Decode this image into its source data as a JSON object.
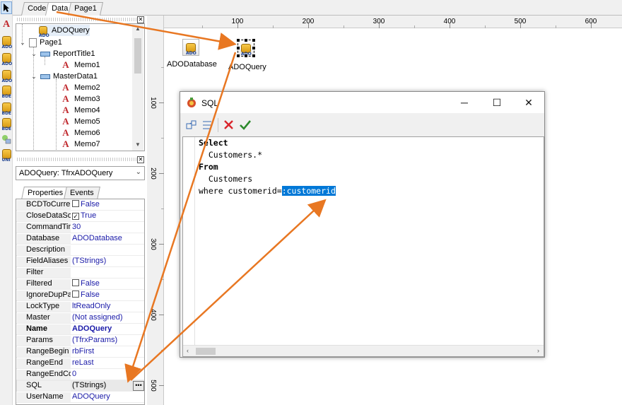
{
  "tabs": [
    "Code",
    "Data",
    "Page1"
  ],
  "palette": {
    "icons": [
      "pointer-icon",
      "text-memo-icon",
      "ado-database-icon",
      "ado-table-icon",
      "ado-query-icon",
      "bde-database-icon",
      "bde-table-icon",
      "bde-query-icon",
      "shapes-icon",
      "uni-database-icon"
    ],
    "badges": [
      "ADO",
      "ADO",
      "ADO",
      "BDE",
      "BDE",
      "BDE",
      "UNI"
    ]
  },
  "tree": {
    "items": [
      {
        "label": "ADOQuery",
        "selected": true
      },
      {
        "label": "Page1"
      },
      {
        "label": "ReportTitle1"
      },
      {
        "label": "Memo1"
      },
      {
        "label": "MasterData1"
      },
      {
        "label": "Memo2"
      },
      {
        "label": "Memo3"
      },
      {
        "label": "Memo4"
      },
      {
        "label": "Memo5"
      },
      {
        "label": "Memo6"
      },
      {
        "label": "Memo7"
      }
    ]
  },
  "object_combo": {
    "value": "ADOQuery: TfrxADOQuery"
  },
  "inspector_tabs": [
    "Properties",
    "Events"
  ],
  "properties": [
    {
      "name": "BCDToCurrer",
      "value": "False",
      "checkbox": false
    },
    {
      "name": "CloseDataSo",
      "value": "True",
      "checkbox": true
    },
    {
      "name": "CommandTim",
      "value": "30"
    },
    {
      "name": "Database",
      "value": "ADODatabase"
    },
    {
      "name": "Description",
      "value": ""
    },
    {
      "name": "FieldAliases",
      "value": "(TStrings)"
    },
    {
      "name": "Filter",
      "value": ""
    },
    {
      "name": "Filtered",
      "value": "False",
      "checkbox": false
    },
    {
      "name": "IgnoreDupPa",
      "value": "False",
      "checkbox": false
    },
    {
      "name": "LockType",
      "value": "ltReadOnly"
    },
    {
      "name": "Master",
      "value": "(Not assigned)"
    },
    {
      "name": "Name",
      "value": "ADOQuery",
      "bold": true
    },
    {
      "name": "Params",
      "value": "(TfrxParams)"
    },
    {
      "name": "RangeBegin",
      "value": "rbFirst"
    },
    {
      "name": "RangeEnd",
      "value": "reLast"
    },
    {
      "name": "RangeEndCo",
      "value": "0"
    },
    {
      "name": "SQL",
      "value": "(TStrings)",
      "ellipsis": true
    },
    {
      "name": "UserName",
      "value": "ADOQuery"
    }
  ],
  "ruler": {
    "h_labels": [
      "100",
      "200",
      "300",
      "400",
      "500",
      "600"
    ],
    "v_labels": [
      "100",
      "200",
      "300",
      "400",
      "500"
    ]
  },
  "components": [
    {
      "label": "ADODatabase",
      "badge": "ADO"
    },
    {
      "label": "ADOQuery",
      "badge": "ADO"
    }
  ],
  "sql_dialog": {
    "title": "SQL",
    "lines": [
      "Select",
      "  Customers.*",
      "From",
      "  Customers",
      "where customerid="
    ],
    "selected_text": ":customerid",
    "window_buttons": [
      "─",
      "☐",
      "✕"
    ]
  },
  "colors": {
    "accent_arrow": "#e87722",
    "selection": "#0078d7",
    "cancel": "#d9242b",
    "ok": "#2c8a2c"
  }
}
